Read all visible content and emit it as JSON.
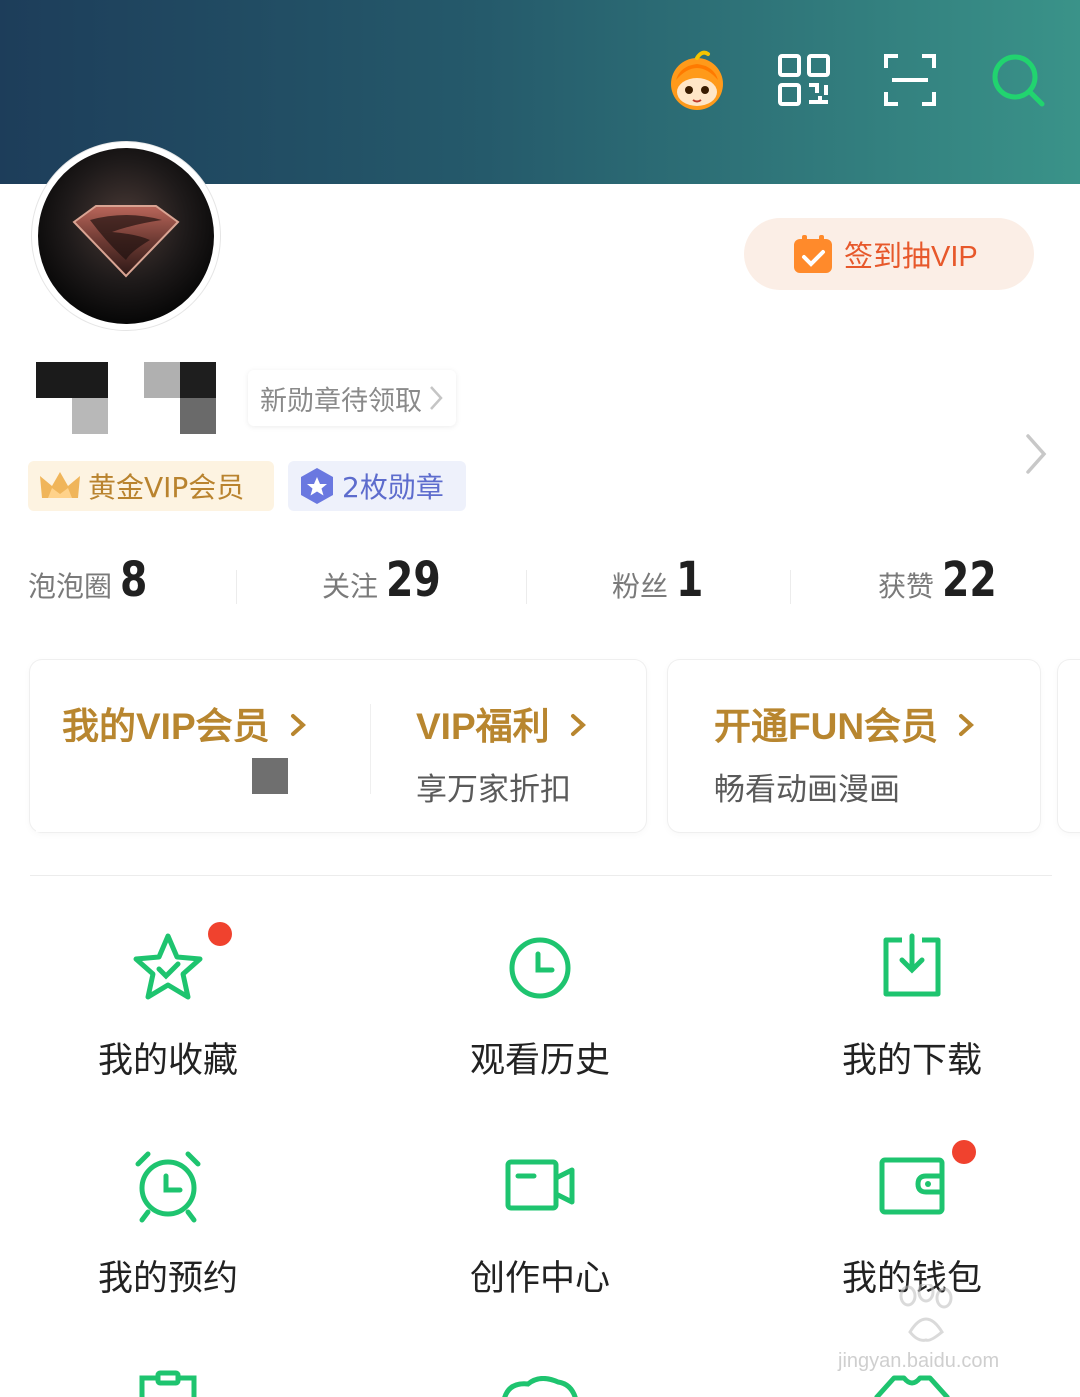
{
  "header": {
    "icons": [
      "mascot-icon",
      "qr-code-icon",
      "scan-icon",
      "search-icon"
    ]
  },
  "signin": {
    "label": "签到抽VIP"
  },
  "medal_tip": {
    "label": "新勋章待领取"
  },
  "badges": {
    "vip": "黄金VIP会员",
    "medal": "2枚勋章"
  },
  "stats": [
    {
      "label": "泡泡圈",
      "value": "8"
    },
    {
      "label": "关注",
      "value": "29"
    },
    {
      "label": "粉丝",
      "value": "1"
    },
    {
      "label": "获赞",
      "value": "22"
    }
  ],
  "cards": {
    "my_vip": {
      "title": "我的VIP会员"
    },
    "vip_welfare": {
      "title": "VIP福利",
      "subtitle": "享万家折扣"
    },
    "fun_member": {
      "title": "开通FUN会员",
      "subtitle": "畅看动画漫画"
    }
  },
  "grid": [
    {
      "label": "我的收藏",
      "icon": "star-check-icon",
      "dot": true
    },
    {
      "label": "观看历史",
      "icon": "clock-icon",
      "dot": false
    },
    {
      "label": "我的下载",
      "icon": "download-icon",
      "dot": false
    },
    {
      "label": "我的预约",
      "icon": "alarm-clock-icon",
      "dot": false
    },
    {
      "label": "创作中心",
      "icon": "video-camera-icon",
      "dot": false
    },
    {
      "label": "我的钱包",
      "icon": "wallet-icon",
      "dot": true
    }
  ],
  "watermark": {
    "text": "jingyan.baidu.com"
  },
  "colors": {
    "accent_green": "#1ec46f",
    "vip_gold": "#b8862f",
    "signin_orange": "#e7582b",
    "notification_red": "#f0422e"
  }
}
